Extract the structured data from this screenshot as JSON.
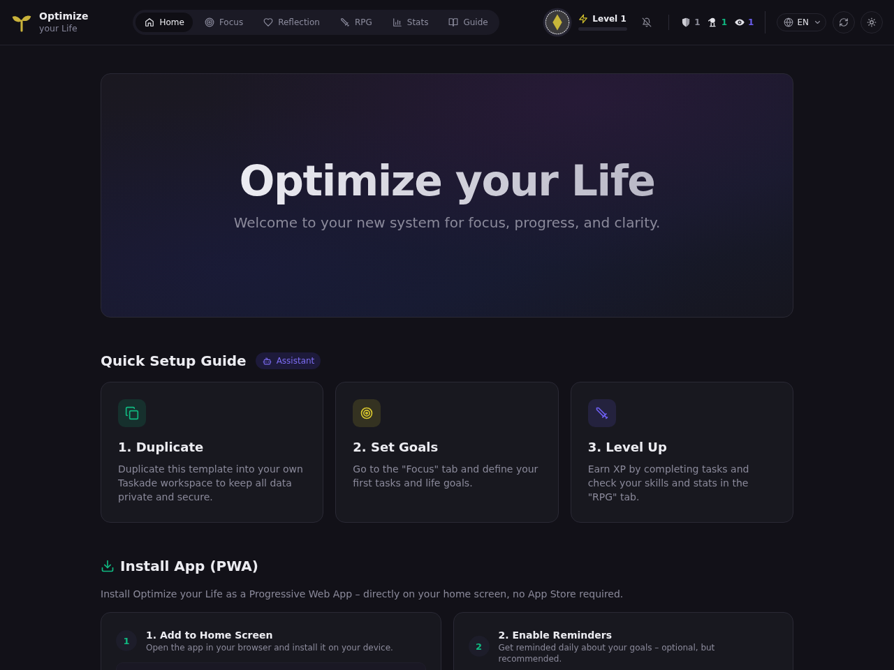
{
  "header": {
    "brand": {
      "title": "Optimize",
      "subtitle": "your Life"
    },
    "nav": [
      {
        "label": "Home",
        "selected": true
      },
      {
        "label": "Focus",
        "selected": false
      },
      {
        "label": "Reflection",
        "selected": false
      },
      {
        "label": "RPG",
        "selected": false
      },
      {
        "label": "Stats",
        "selected": false
      },
      {
        "label": "Guide",
        "selected": false
      }
    ],
    "player": {
      "level_label": "Level 1"
    },
    "stats": [
      {
        "value": "1",
        "color": "#8c8c99"
      },
      {
        "value": "1",
        "color": "#10b981"
      },
      {
        "value": "1",
        "color": "#6d5ff0"
      }
    ],
    "language": {
      "value": "EN"
    }
  },
  "hero": {
    "title": "Optimize your Life",
    "subtitle": "Welcome to your new system for focus, progress, and clarity."
  },
  "setup_guide": {
    "title": "Quick Setup Guide",
    "tag": "Assistant",
    "steps": [
      {
        "title": "1. Duplicate",
        "text": "Duplicate this template into your own Taskade workspace to keep all data private and secure.",
        "color": "#10b981"
      },
      {
        "title": "2. Set Goals",
        "text": "Go to the \"Focus\" tab and define your first tasks and life goals.",
        "color": "#d9c72e"
      },
      {
        "title": "3. Level Up",
        "text": "Earn XP by completing tasks and check your skills and stats in the \"RPG\" tab.",
        "color": "#6d5ff0"
      }
    ]
  },
  "install": {
    "title": "Install App (PWA)",
    "description": "Install Optimize your Life as a Progressive Web App – directly on your home screen, no App Store required.",
    "steps": [
      {
        "number": "1",
        "title": "1. Add to Home Screen",
        "text": "Open the app in your browser and install it on your device."
      },
      {
        "number": "2",
        "title": "2. Enable Reminders",
        "text": "Get reminded daily about your goals – optional, but recommended."
      }
    ]
  }
}
